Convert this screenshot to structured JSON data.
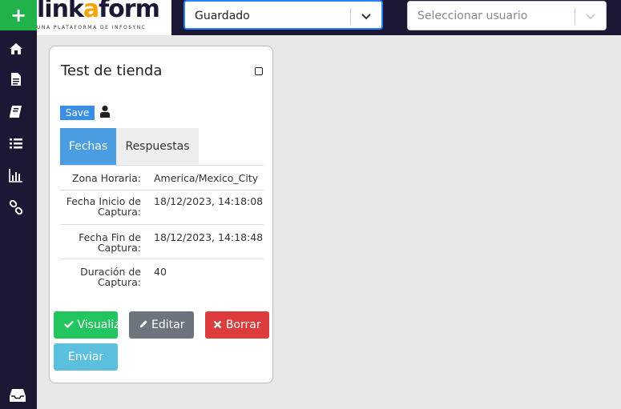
{
  "sidebar": {
    "add_label": "+",
    "items": [
      "home-icon",
      "file-icon",
      "book-icon",
      "list-icon",
      "chart-icon",
      "link-icon"
    ],
    "bottom_icon": "inbox-icon",
    "bg_color": "#1b1734"
  },
  "header": {
    "logo_part1": "link",
    "logo_accent": "a",
    "logo_part2": "form",
    "logo_tagline": "UNA PLATAFORMA DE INFOSYNC",
    "status_select": {
      "value": "Guardado"
    },
    "user_select": {
      "placeholder": "Seleccionar usuario"
    }
  },
  "card": {
    "title": "Test de tienda",
    "save_label": "Save",
    "tabs": [
      {
        "label": "Fechas",
        "active": true
      },
      {
        "label": "Respuestas",
        "active": false
      }
    ],
    "rows": [
      {
        "label": "Zona Horaria:",
        "value": "America/Mexico_City"
      },
      {
        "label_line1": "Fecha Inicio de",
        "label_line2": "Captura:",
        "value": "18/12/2023, 14:18:08"
      },
      {
        "label_line1": "Fecha Fin de",
        "label_line2": "Captura:",
        "value": "18/12/2023, 14:18:48"
      },
      {
        "label_line1": "Duración de",
        "label_line2": "Captura:",
        "value": "40"
      }
    ],
    "buttons": {
      "visualizar": "Visualizar",
      "editar": "Editar",
      "borrar": "Borrar",
      "enviar": "Enviar"
    }
  },
  "colors": {
    "accent_green": "#22b24c",
    "tab_active": "#4a9de0",
    "danger": "#dc3c3c",
    "info": "#5bc0de"
  }
}
